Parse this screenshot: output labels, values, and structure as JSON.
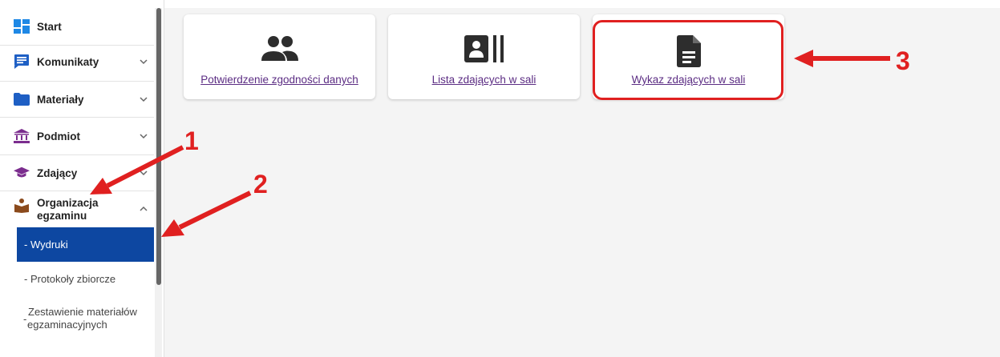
{
  "sidebar": {
    "items": [
      {
        "label": "Start",
        "icon": "dashboard-icon"
      },
      {
        "label": "Komunikaty",
        "icon": "message-icon"
      },
      {
        "label": "Materiały",
        "icon": "folder-icon"
      },
      {
        "label": "Podmiot",
        "icon": "institution-icon"
      },
      {
        "label": "Zdający",
        "icon": "graduation-cap-icon"
      },
      {
        "label_line1": "Organizacja",
        "label_line2": "egzaminu",
        "icon": "reading-person-icon"
      }
    ],
    "subitems": {
      "active": "- Wydruki",
      "protokoly": "- Protokoły zbiorcze",
      "zestawienie_dash": "-",
      "zestawienie_line1": "Zestawienie materiałów",
      "zestawienie_line2": "egzaminacyjnych"
    }
  },
  "cards": [
    {
      "label": "Potwierdzenie zgodności danych",
      "icon": "people-icon"
    },
    {
      "label": "Lista zdających w sali",
      "icon": "contact-list-icon"
    },
    {
      "label": "Wykaz zdających w sali",
      "icon": "document-icon"
    }
  ],
  "annotations": {
    "n1": "1",
    "n2": "2",
    "n3": "3"
  },
  "colors": {
    "accent": "#0d47a1",
    "link": "#5b2c83",
    "annotation": "#e02020",
    "icon_purple": "#7b2d8e"
  }
}
